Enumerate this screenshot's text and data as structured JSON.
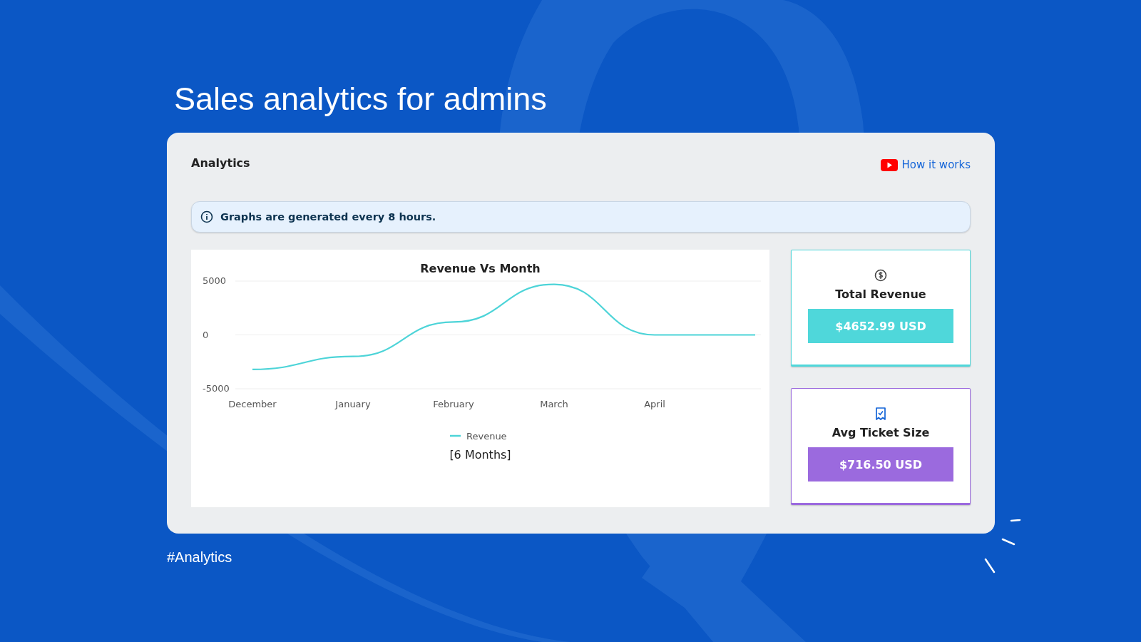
{
  "headline": "Sales analytics for admins",
  "panel": {
    "title": "Analytics",
    "help_link": "How it works"
  },
  "notice": "Graphs are generated every 8 hours.",
  "chart_data": {
    "type": "line",
    "title": "Revenue Vs Month",
    "categories": [
      "December",
      "January",
      "February",
      "March",
      "April",
      null
    ],
    "yticks": [
      -5000,
      0,
      5000
    ],
    "ylim": [
      -5000,
      5000
    ],
    "series": [
      {
        "name": "Revenue",
        "color": "#4dd4d8",
        "values": [
          -3200,
          -2000,
          1200,
          4700,
          0,
          0
        ]
      }
    ],
    "xlabel": "[6 Months]"
  },
  "stats": [
    {
      "kind": "revenue",
      "label": "Total Revenue",
      "value": "$4652.99 USD",
      "color": "#4fd7da"
    },
    {
      "kind": "ticket",
      "label": "Avg Ticket Size",
      "value": "$716.50 USD",
      "color": "#9b6ade"
    }
  ],
  "footer_tag": "#Analytics"
}
